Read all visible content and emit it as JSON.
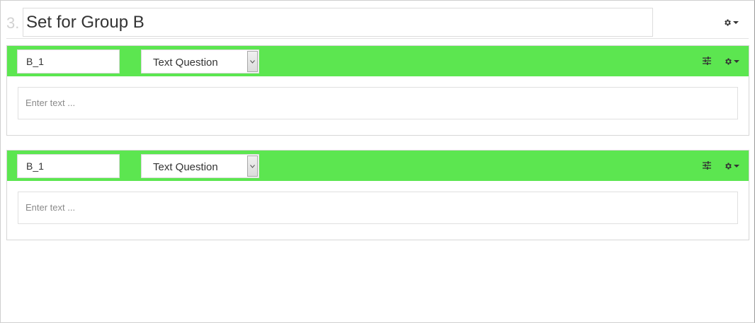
{
  "group": {
    "number": "3.",
    "title": "Set for Group B"
  },
  "questions": [
    {
      "code": "B_1",
      "type": "Text Question",
      "answer_placeholder": "Enter text ..."
    },
    {
      "code": "B_1",
      "type": "Text Question",
      "answer_placeholder": "Enter text ..."
    }
  ],
  "icons": {
    "group_settings": "gear-icon",
    "question_settings": "gear-icon",
    "question_options": "sliders-icon",
    "dropdown": "caret-down-icon"
  },
  "colors": {
    "question_bar": "#5ce650",
    "group_number": "#d2d2d2",
    "placeholder": "#8a8a8a"
  }
}
